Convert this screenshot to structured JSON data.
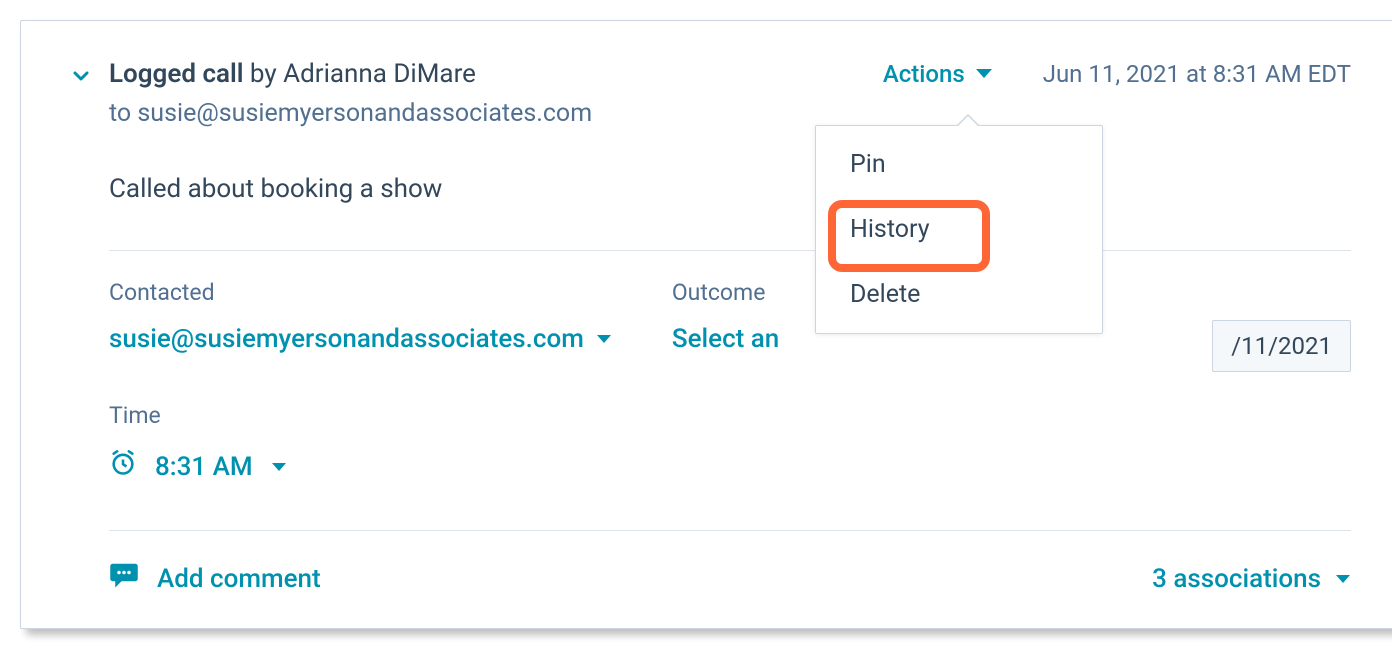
{
  "header": {
    "activity_type": "Logged call",
    "by_word": " by ",
    "author": "Adrianna DiMare",
    "actions_label": "Actions",
    "timestamp": "Jun 11, 2021 at 8:31 AM EDT"
  },
  "recipient": {
    "to_word": "to ",
    "email": "susie@susiemyersonandassociates.com"
  },
  "body": "Called about booking a show",
  "fields": {
    "contacted_label": "Contacted",
    "contacted_value": "susie@susiemyersonandassociates.com",
    "outcome_label": "Outcome",
    "outcome_value_visible": "Select an",
    "date_value_visible": "/11/2021",
    "time_label": "Time",
    "time_value": "8:31 AM"
  },
  "footer": {
    "add_comment": "Add comment",
    "associations": "3 associations"
  },
  "dropdown": {
    "items": [
      "Pin",
      "History",
      "Delete"
    ]
  }
}
